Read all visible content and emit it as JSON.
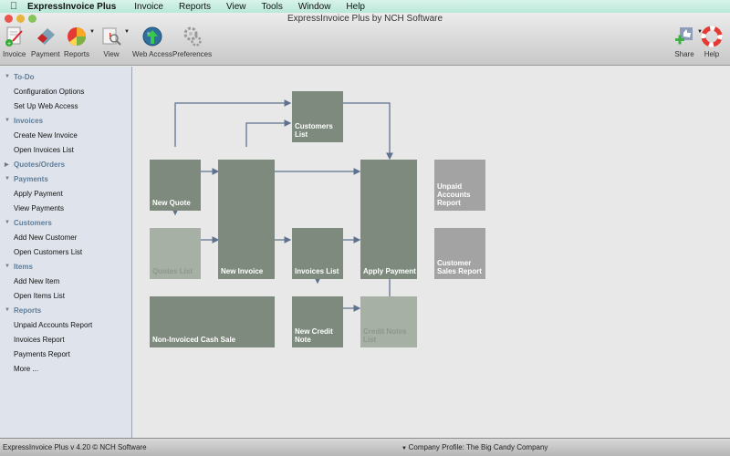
{
  "menubar": {
    "app_name": "ExpressInvoice Plus",
    "items": [
      "Invoice",
      "Reports",
      "View",
      "Tools",
      "Window",
      "Help"
    ]
  },
  "window": {
    "title": "ExpressInvoice Plus by NCH Software"
  },
  "toolbar": {
    "left": [
      {
        "label": "Invoice",
        "icon": "invoice-icon"
      },
      {
        "label": "Payment",
        "icon": "payment-icon"
      },
      {
        "label": "Reports",
        "icon": "reports-icon",
        "dropdown": true
      },
      {
        "label": "View",
        "icon": "view-icon",
        "dropdown": true
      },
      {
        "label": "Web Access",
        "icon": "web-access-icon"
      },
      {
        "label": "Preferences",
        "icon": "preferences-icon"
      }
    ],
    "right": [
      {
        "label": "Share",
        "icon": "share-icon",
        "dropdown": true
      },
      {
        "label": "Help",
        "icon": "help-lifebuoy-icon"
      }
    ]
  },
  "sidebar": {
    "groups": [
      {
        "label": "To-Do",
        "expanded": true,
        "items": [
          "Configuration Options",
          "Set Up Web Access"
        ]
      },
      {
        "label": "Invoices",
        "expanded": true,
        "items": [
          "Create New Invoice",
          "Open Invoices List"
        ]
      },
      {
        "label": "Quotes/Orders",
        "expanded": false,
        "items": []
      },
      {
        "label": "Payments",
        "expanded": true,
        "items": [
          "Apply Payment",
          "View Payments"
        ]
      },
      {
        "label": "Customers",
        "expanded": true,
        "items": [
          "Add New Customer",
          "Open Customers List"
        ]
      },
      {
        "label": "Items",
        "expanded": true,
        "items": [
          "Add New Item",
          "Open Items List"
        ]
      },
      {
        "label": "Reports",
        "expanded": true,
        "items": [
          "Unpaid Accounts Report",
          "Invoices Report",
          "Payments Report",
          "More ..."
        ]
      }
    ]
  },
  "flow": {
    "customers_list": "Customers List",
    "new_quote": "New Quote",
    "new_invoice": "New Invoice",
    "apply_payment": "Apply Payment",
    "unpaid_accounts_report": "Unpaid Accounts Report",
    "quotes_list": "Quotes List",
    "invoices_list": "Invoices List",
    "customer_sales_report": "Customer Sales Report",
    "non_invoiced_cash_sale": "Non-Invoiced Cash Sale",
    "new_credit_note": "New Credit Note",
    "credit_notes_list": "Credit Notes List"
  },
  "status": {
    "version": "ExpressInvoice Plus v 4.20 © NCH Software",
    "company_profile": "Company Profile: The Big Candy Company"
  },
  "colors": {
    "box_dark": "#7e8a7d",
    "box_light": "#a6b0a5",
    "box_gray": "#a3a3a3",
    "arrow": "#5f7390",
    "sidebar_bg": "#dfe4ec",
    "group_label": "#5d7c98"
  }
}
